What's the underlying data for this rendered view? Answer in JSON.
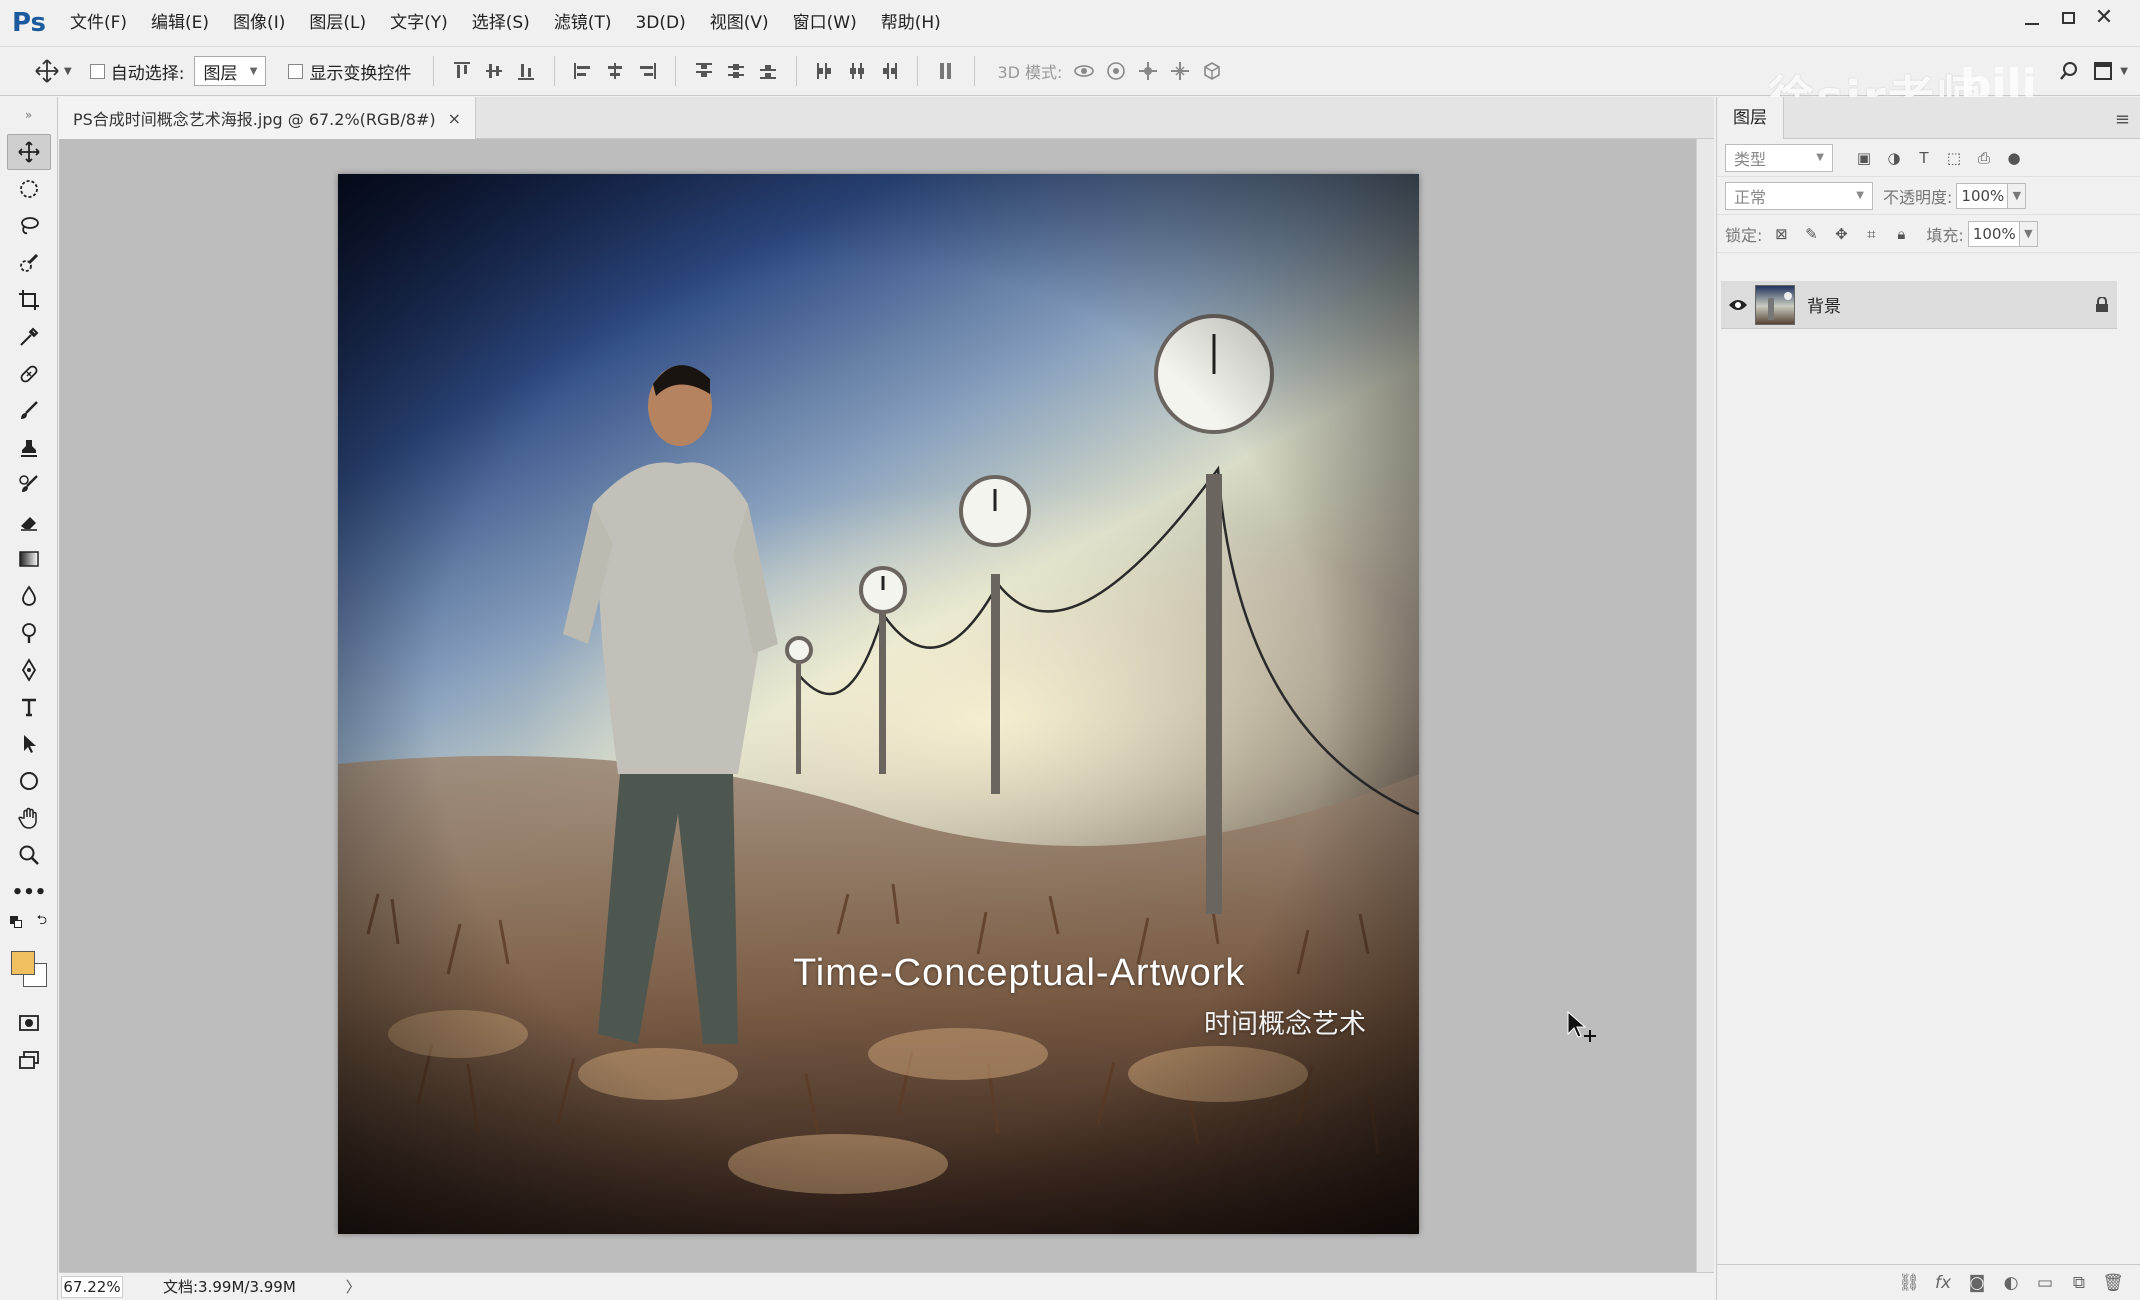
{
  "app": {
    "logo": "Ps",
    "menu": [
      "文件(F)",
      "编辑(E)",
      "图像(I)",
      "图层(L)",
      "文字(Y)",
      "选择(S)",
      "滤镜(T)",
      "3D(D)",
      "视图(V)",
      "窗口(W)",
      "帮助(H)"
    ]
  },
  "options": {
    "auto_select_label": "自动选择:",
    "auto_select_value": "图层",
    "show_transform_label": "显示变换控件",
    "mode_3d_label": "3D 模式:",
    "watermark": "徐sir老师",
    "watermark2": "bili"
  },
  "document": {
    "tab_label": "PS合成时间概念艺术海报.jpg @ 67.2%(RGB/8#)",
    "tab_close": "×",
    "artwork_title": "Time-Conceptual-Artwork",
    "artwork_subtitle": "时间概念艺术"
  },
  "status": {
    "zoom": "67.22%",
    "doc_info": "文档:3.99M/3.99M",
    "arrow": "〉"
  },
  "layers_panel": {
    "tab": "图层",
    "filter_placeholder": "类型",
    "blend_mode": "正常",
    "opacity_label": "不透明度:",
    "opacity_value": "100%",
    "lock_label": "锁定:",
    "fill_label": "填充:",
    "fill_value": "100%",
    "layers": [
      {
        "name": "背景",
        "visible": true,
        "locked": true
      }
    ]
  },
  "colors": {
    "foreground": "#f0c060",
    "background": "#ffffff",
    "ps_blue": "#1c5a9e"
  }
}
